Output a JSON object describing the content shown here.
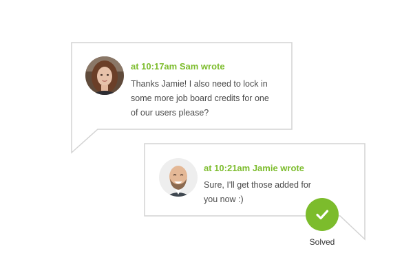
{
  "colors": {
    "accent": "#7cbc2c",
    "border": "#d3d3d3",
    "body_text": "#4a4a4a",
    "background": "#ffffff"
  },
  "messages": [
    {
      "author_line": "at 10:17am Sam wrote",
      "lines": [
        "Thanks Jamie! I also need to lock in",
        "some more job board credits for one",
        "of our users please?"
      ],
      "avatar": "woman-avatar"
    },
    {
      "author_line": "at 10:21am Jamie wrote",
      "lines": [
        "Sure, I'll get those added for",
        "you now :)"
      ],
      "avatar": "bald-man-avatar"
    }
  ],
  "status": {
    "label": "Solved",
    "icon": "checkmark-icon"
  }
}
